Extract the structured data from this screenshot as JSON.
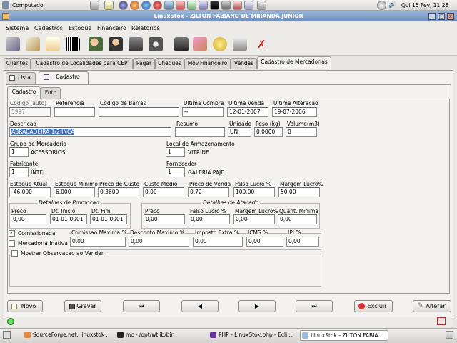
{
  "top_panel": {
    "computer_label": "Computador",
    "clock": "Qui 15 Fev, 11:28"
  },
  "window": {
    "title": "LinuxStok - ZILTON FABIANO DE MIRANDA JUNIOR",
    "close": "x",
    "maximize": "□",
    "minimize": "_"
  },
  "menu": {
    "items": [
      "Sistema",
      "Cadastros",
      "Estoque",
      "Financeiro",
      "Relatorios"
    ]
  },
  "toolbar": {
    "icons": [
      "tools-icon",
      "wrench-icon",
      "notepad-icon",
      "barcode-icon",
      "users-icon",
      "user-icon",
      "briefcase-icon",
      "camera-icon",
      "cargo-icon",
      "map-icon",
      "coins-icon",
      "printer-icon",
      "close-red-icon"
    ]
  },
  "main_tabs": [
    "Clientes",
    "Cadastro de Localidades para CEP",
    "Pagar",
    "Cheques",
    "Mov.Financeiro",
    "Vendas",
    "Cadastro de Mercadorias"
  ],
  "view_tabs": {
    "lista": "Lista",
    "cadastro": "Cadastro"
  },
  "sub_tabs": {
    "cadastro": "Cadastro",
    "foto": "Foto"
  },
  "form": {
    "codigo": {
      "label": "Codigo (auto)",
      "value": "5997"
    },
    "referencia": {
      "label": "Referencia",
      "value": ""
    },
    "codigo_barras": {
      "label": "Codigo de Barras",
      "value": ""
    },
    "ultima_compra": {
      "label": "Ultima Compra",
      "value": "--"
    },
    "ultima_venda": {
      "label": "Ultima Venda",
      "value": "12-01-2007"
    },
    "ultima_alteracao": {
      "label": "Ultima Alteracao",
      "value": "19-07-2006"
    },
    "descricao": {
      "label": "Descricao",
      "value": "ABRACADEIRA 1/2 INCA"
    },
    "resumo": {
      "label": "Resumo",
      "value": ""
    },
    "unidade": {
      "label": "Unidade",
      "value": "UN"
    },
    "peso": {
      "label": "Peso (kg)",
      "value": "0,0000"
    },
    "volume": {
      "label": "Volume(m3)",
      "value": "0"
    },
    "grupo": {
      "label": "Grupo de Mercadoria",
      "code": "1",
      "name": "ACESSORIOS"
    },
    "local": {
      "label": "Local de Armazenamento",
      "code": "1",
      "name": "VITRINE"
    },
    "fabricante": {
      "label": "Fabricante",
      "code": "1",
      "name": "INTEL"
    },
    "fornecedor": {
      "label": "Fornecedor",
      "code": "1",
      "name": "GALERIA PAJE"
    },
    "estoque_atual": {
      "label": "Estoque Atual",
      "value": "-46,000"
    },
    "estoque_minimo": {
      "label": "Estoque Minimo",
      "value": "6,000"
    },
    "preco_custo": {
      "label": "Preco de Custo",
      "value": "0,3600"
    },
    "custo_medio": {
      "label": "Custo Medio",
      "value": "0,00"
    },
    "preco_venda": {
      "label": "Preco de Venda",
      "value": "0,72"
    },
    "falso_lucro": {
      "label": "Falso Lucro %",
      "value": "100,00"
    },
    "margem_lucro": {
      "label": "Margem Lucro%",
      "value": "50,00"
    },
    "promocao": {
      "title": "Detalhes de Promocao",
      "preco_label": "Preco",
      "preco": "0,00",
      "dt_inicio_label": "Dt. Inicio",
      "dt_inicio": "01-01-0001",
      "dt_fim_label": "Dt. Fim",
      "dt_fim": "01-01-0001"
    },
    "atacado": {
      "title": "Detalhes de Atacado",
      "preco_label": "Preco",
      "preco": "0,00",
      "falso_lucro_label": "Falso Lucro %",
      "falso_lucro": "0,00",
      "margem_label": "Margem Lucro%",
      "margem": "0,00",
      "quant_label": "Quant. Minima",
      "quant": "0,00"
    },
    "comissionada": {
      "label": "Comissionada",
      "checked": true
    },
    "inativa": {
      "label": "Mercadoria Inativa",
      "checked": false
    },
    "mostrar_obs": {
      "label": "Mostrar Observacao ao Vender",
      "checked": false
    },
    "comissao_max": {
      "label": "Comissao Maxima %",
      "value": "0,00"
    },
    "desconto_max": {
      "label": "Desconto Maximo %",
      "value": "0,00"
    },
    "imposto_extra": {
      "label": "Imposto Extra %",
      "value": "0,00"
    },
    "icms": {
      "label": "ICMS %",
      "value": "0,00"
    },
    "ipi": {
      "label": "IPI %",
      "value": "0,00"
    }
  },
  "buttons": {
    "novo": "Novo",
    "gravar": "Gravar",
    "excluir": "Excluir",
    "alterar": "Alterar"
  },
  "taskbar": {
    "items": [
      "SourceForge.net: linuxstok ...",
      "mc - /opt/wtlib/bin",
      "PHP - LinuxStok.php - Ecli...",
      "LinuxStok - ZILTON FABIA..."
    ]
  },
  "colors": {
    "titlebar": "#7b9bc8",
    "selection": "#4a74b8",
    "panel": "#f3f2f0"
  }
}
